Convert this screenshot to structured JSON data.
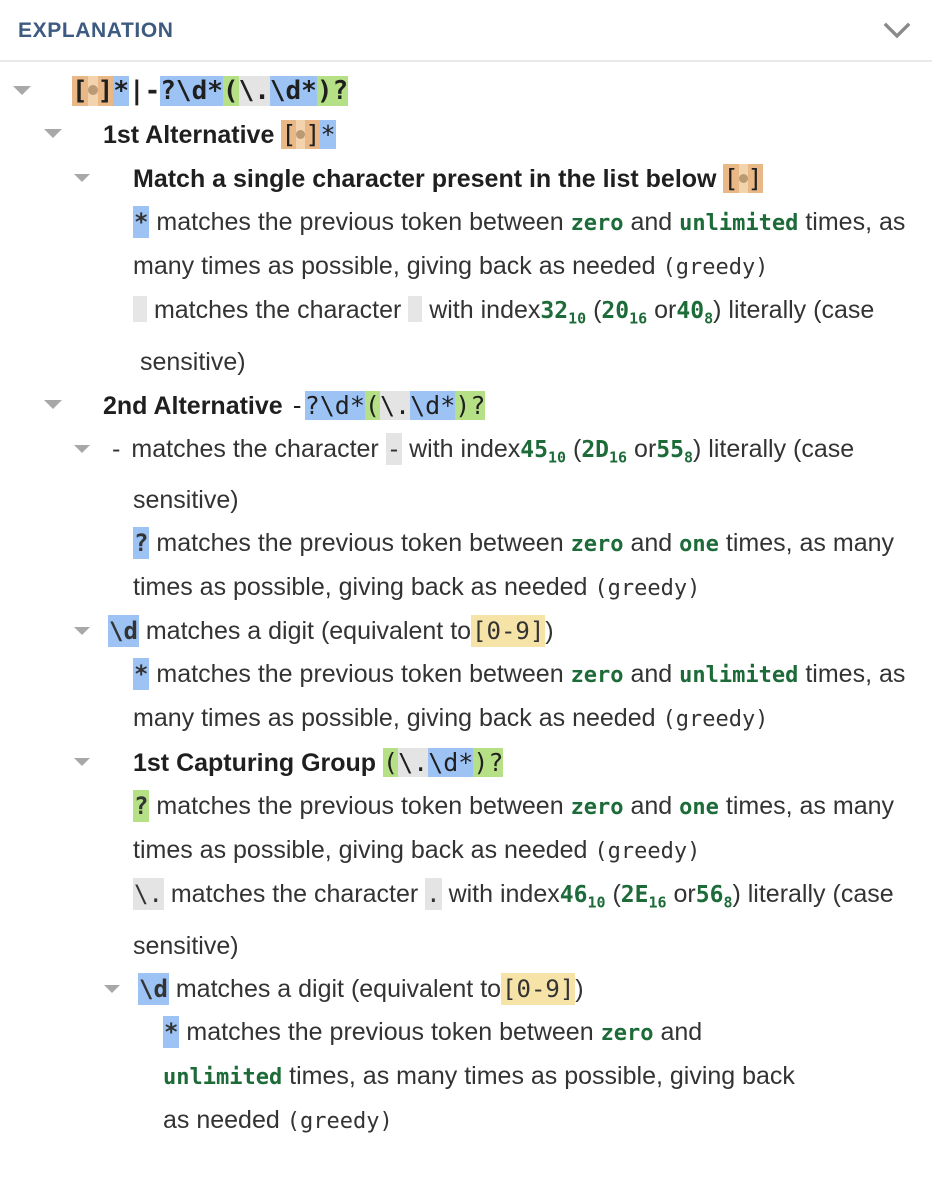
{
  "header": {
    "title": "EXPLANATION",
    "collapse_icon": "chevron-down-icon"
  },
  "regex": {
    "full_pattern": "[ ]*|-?\\d*(\\.\\d*)?",
    "display_pattern_parts": [
      {
        "text": "[",
        "hl": "orange"
      },
      {
        "text": "·",
        "hl": "peach"
      },
      {
        "text": "]",
        "hl": "orange"
      },
      {
        "text": "*",
        "hl": "blue"
      },
      {
        "text": "|",
        "hl": "none"
      },
      {
        "text": "-",
        "hl": "none"
      },
      {
        "text": "?\\d*",
        "hl": "blue"
      },
      {
        "text": "(",
        "hl": "green"
      },
      {
        "text": "\\.",
        "hl": "grey"
      },
      {
        "text": "\\d*",
        "hl": "blue"
      },
      {
        "text": ")",
        "hl": "green"
      },
      {
        "text": "?",
        "hl": "green"
      }
    ]
  },
  "nodes": {
    "alt1_label": "1st Alternative",
    "alt1_pattern": "[·]*",
    "charclass_label": "Match a single character present in the list below",
    "charclass_pattern": "[·]",
    "star_token": "*",
    "star_desc_a": "matches the previous token between",
    "star_zero": "zero",
    "star_and": "and",
    "star_unlimited": "unlimited",
    "star_desc_b": "times, as many times as possible, giving back as needed",
    "greedy": "(greedy)",
    "space_matches": "matches the character",
    "space_withindex": "with index",
    "space_dec": "32",
    "space_dec_sub": "10",
    "space_hex": "20",
    "space_hex_sub": "16",
    "space_oct": "40",
    "space_oct_sub": "8",
    "space_or": "or",
    "literally": "literally (case sensitive)",
    "alt2_label": "2nd Alternative",
    "alt2_pattern": "-?\\d*(\\.\\d*)?",
    "dash_token": "-",
    "dash_matches": "matches the character",
    "dash_char": "-",
    "dash_withindex": "with index",
    "dash_dec": "45",
    "dash_dec_sub": "10",
    "dash_hex": "2D",
    "dash_hex_sub": "16",
    "dash_oct": "55",
    "dash_oct_sub": "8",
    "q_token": "?",
    "q_desc_a": "matches the previous token between",
    "q_zero": "zero",
    "q_and": "and",
    "q_one": "one",
    "q_desc_b": "times,",
    "q_desc_c": "as many times as possible, giving back as needed",
    "digit_token": "\\d",
    "digit_desc": "matches a digit (equivalent to",
    "digit_class": "[0-9]",
    "digit_close": ")",
    "group_label": "1st Capturing Group",
    "group_pattern": "(\\.\\d*)?",
    "dot_token": "\\.",
    "dot_matches": "matches the character",
    "dot_char": ".",
    "dot_withindex": "with index",
    "dot_dec": "46",
    "dot_dec_sub": "10",
    "dot_hex": "2E",
    "dot_hex_sub": "16",
    "dot_oct": "56",
    "dot_oct_sub": "8"
  },
  "colors": {
    "header_text": "#3d5a80",
    "highlight_blue": "#9dc3f5",
    "highlight_green": "#b6e086",
    "highlight_orange": "#eab886",
    "highlight_peach": "#f3d3ae",
    "highlight_grey": "#e4e4e4",
    "highlight_yellow": "#f6e3a8",
    "green_text": "#1d6b39"
  }
}
